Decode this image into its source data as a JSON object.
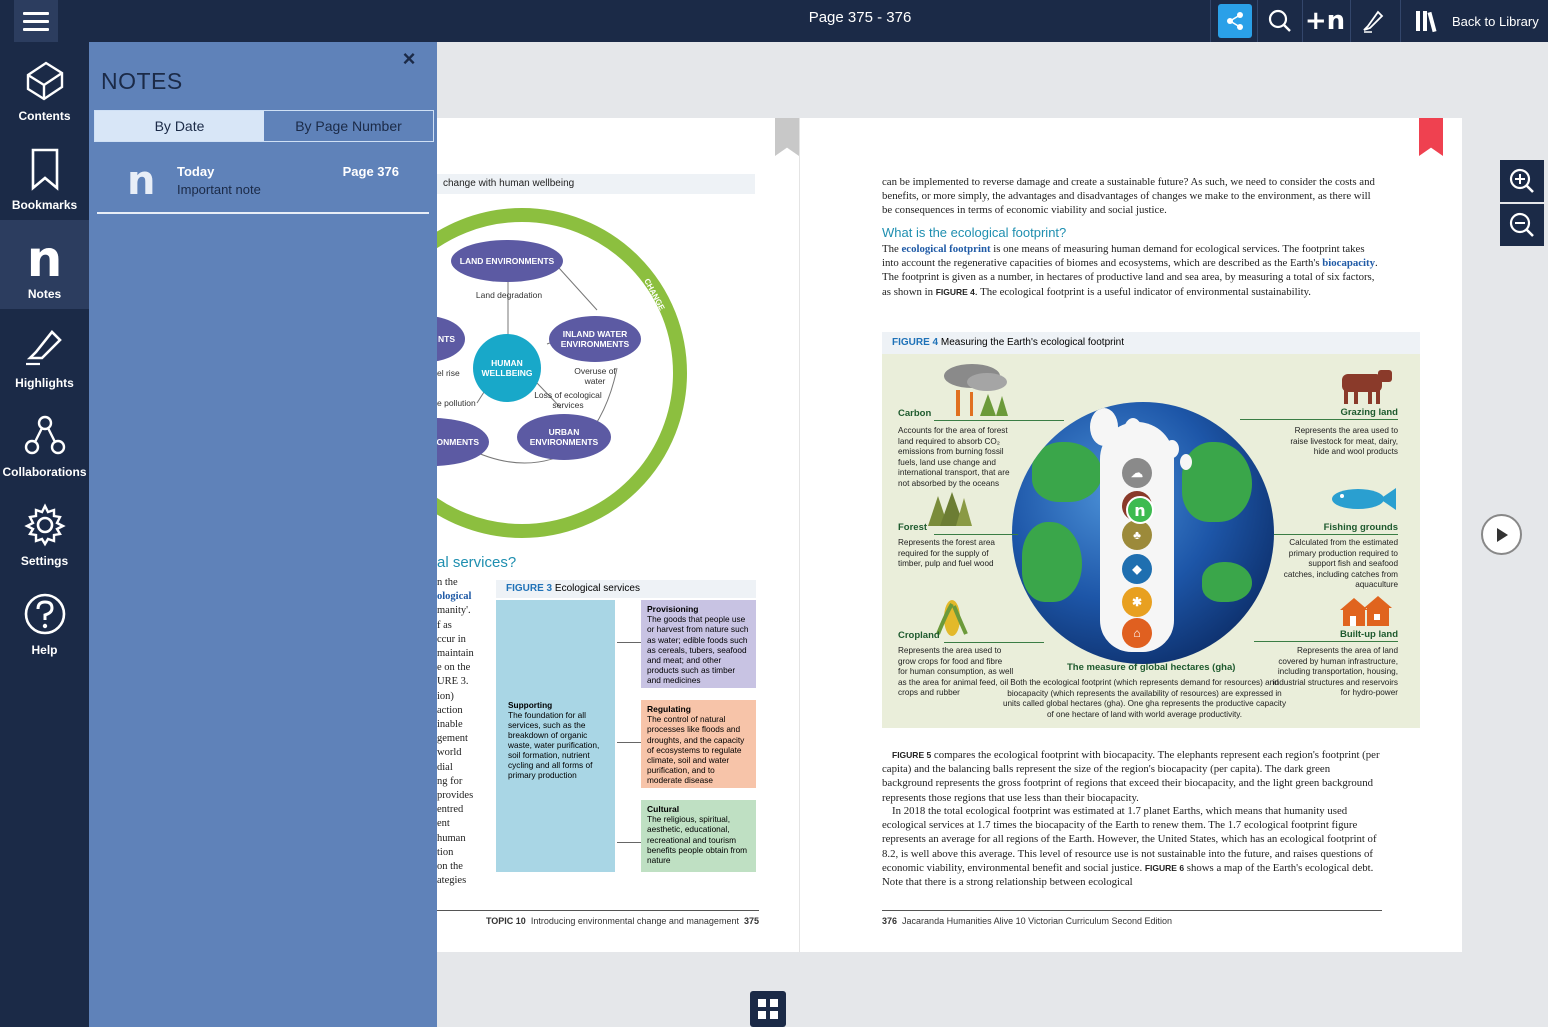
{
  "topbar": {
    "page_label": "Page 375 - 376",
    "back_label": "Back to Library",
    "add_note_glyph": "+n"
  },
  "sidebar": {
    "items": [
      {
        "label": "Contents",
        "icon": "book-icon"
      },
      {
        "label": "Bookmarks",
        "icon": "bookmark-icon"
      },
      {
        "label": "Notes",
        "icon": "notes-icon",
        "glyph": "n"
      },
      {
        "label": "Highlights",
        "icon": "highlighter-icon"
      },
      {
        "label": "Collaborations",
        "icon": "collaboration-icon"
      },
      {
        "label": "Settings",
        "icon": "gear-icon"
      },
      {
        "label": "Help",
        "icon": "help-icon"
      }
    ]
  },
  "notes": {
    "title": "NOTES",
    "close_glyph": "×",
    "tabs": [
      "By Date",
      "By Page Number"
    ],
    "entries": [
      {
        "glyph": "n",
        "date": "Today",
        "text": "Important note",
        "page": "Page 376"
      }
    ]
  },
  "left_page": {
    "fig2_caption": "change with human wellbeing",
    "diagram": {
      "land": "LAND ENVIRONMENTS",
      "inland": "INLAND WATER ENVIRONMENTS",
      "human": "HUMAN WELLBEING",
      "urban": "URBAN ENVIRONMENTS",
      "marine": "ARINE ONMENTS",
      "coastal": "NTS",
      "land_degradation": "Land degradation",
      "overuse": "Overuse of water",
      "loss": "Loss of ecological services",
      "sea_rise": "el rise",
      "pollution": "e pollution",
      "change": "CHANGE"
    },
    "heading": "al services?",
    "col_text": [
      "n the",
      "ological",
      "manity'.",
      "f as",
      "ccur in",
      "maintain",
      "e on the",
      "URE 3.",
      "ion)",
      "action",
      "inable",
      "gement",
      "world",
      "dial",
      "ng for",
      "provides",
      "entred",
      "ent",
      "human",
      "tion",
      "on the",
      "ategies"
    ],
    "fig3": {
      "label": "FIGURE 3",
      "title": "Ecological services",
      "supporting_title": "Supporting",
      "supporting_text": "The foundation for all services, such as the breakdown of organic waste, water purification, soil formation, nutrient cycling and all forms of primary production",
      "provisioning_title": "Provisioning",
      "provisioning_text": "The goods that people use or harvest from nature such as water; edible foods such as cereals, tubers, seafood and meat; and other products such as timber and medicines",
      "regulating_title": "Regulating",
      "regulating_text": "The control of natural processes like floods and droughts, and the capacity of ecosystems to regulate climate, soil and water purification, and to moderate disease",
      "cultural_title": "Cultural",
      "cultural_text": "The religious, spiritual, aesthetic, educational, recreational and tourism benefits people obtain from nature"
    },
    "footer_topic": "TOPIC 10",
    "footer_text": "Introducing environmental change and management",
    "footer_page": "375"
  },
  "right_page": {
    "para1": "can be implemented to reverse damage and create a sustainable future? As such, we need to consider the costs and benefits, or more simply, the advantages and disadvantages of changes we make to the environment, as there will be consequences in terms of economic viability and social justice.",
    "heading": "What is the ecological footprint?",
    "para2_a": "The ",
    "para2_kw1": "ecological footprint",
    "para2_b": " is one means of measuring human demand for ecological services. The footprint takes into account the regenerative capacities of biomes and ecosystems, which are described as the Earth's ",
    "para2_kw2": "biocapacity",
    "para2_c": ". The footprint is given as a number, in hectares of productive land and sea area, by measuring a total of six factors, as shown in ",
    "para2_ref": "FIGURE 4",
    "para2_d": ". The ecological footprint is a useful indicator of environmental sustainability.",
    "fig4": {
      "label": "FIGURE 4",
      "title": "Measuring the Earth's ecological footprint",
      "carbon": "Carbon",
      "carbon_desc": "Accounts for the area of forest land required to absorb CO₂ emissions from burning fossil fuels, land use change and international transport, that are not absorbed by the oceans",
      "grazing": "Grazing land",
      "grazing_desc": "Represents the area used to raise livestock for meat, dairy, hide and wool products",
      "forest": "Forest",
      "forest_desc": "Represents the forest area required for the supply of timber, pulp and fuel wood",
      "fishing": "Fishing grounds",
      "fishing_desc": "Calculated from the estimated primary production required to support fish and seafood catches, including catches from aquaculture",
      "cropland": "Cropland",
      "cropland_desc": "Represents the area used to grow crops for food and fibre for human consumption, as well as the area for animal feed, oil crops and rubber",
      "builtup": "Built-up land",
      "builtup_desc": "Represents the area of land covered by human infrastructure, including transportation, housing, industrial structures and reservoirs for hydro-power",
      "measure_title": "The measure of global hectares (gha)",
      "measure_desc": "Both the ecological footprint (which represents demand for resources) and biocapacity (which represents the availability of resources) are expressed in units called global hectares (gha). One gha represents the productive capacity of one hectare of land with world average productivity.",
      "note_marker": "n"
    },
    "para3_ref": "FIGURE 5",
    "para3": " compares the ecological footprint with biocapacity. The elephants represent each region's footprint (per capita) and the balancing balls represent the size of the region's biocapacity (per capita). The dark green background represents the gross footprint of regions that exceed their biocapacity, and the light green background represents those regions that use less than their biocapacity.",
    "para4": "In 2018 the total ecological footprint was estimated at 1.7 planet Earths, which means that humanity used ecological services at 1.7 times the biocapacity of the Earth to renew them. The 1.7 ecological footprint figure represents an average for all regions of the Earth. However, the United States, which has an ecological footprint of 8.2, is well above this average. This level of resource use is not sustainable into the future, and raises questions of economic viability, environmental benefit and social justice. ",
    "para4_ref": "FIGURE 6",
    "para4_end": " shows a map of the Earth's ecological debt. Note that there is a strong relationship between ecological",
    "footer_page": "376",
    "footer_text": "Jacaranda Humanities Alive 10 Victorian Curriculum Second Edition"
  },
  "colors": {
    "navy": "#1b2a47",
    "panel_blue": "#5f82b9",
    "share_blue": "#2aa0e8",
    "bookmark_red": "#ef4150"
  }
}
